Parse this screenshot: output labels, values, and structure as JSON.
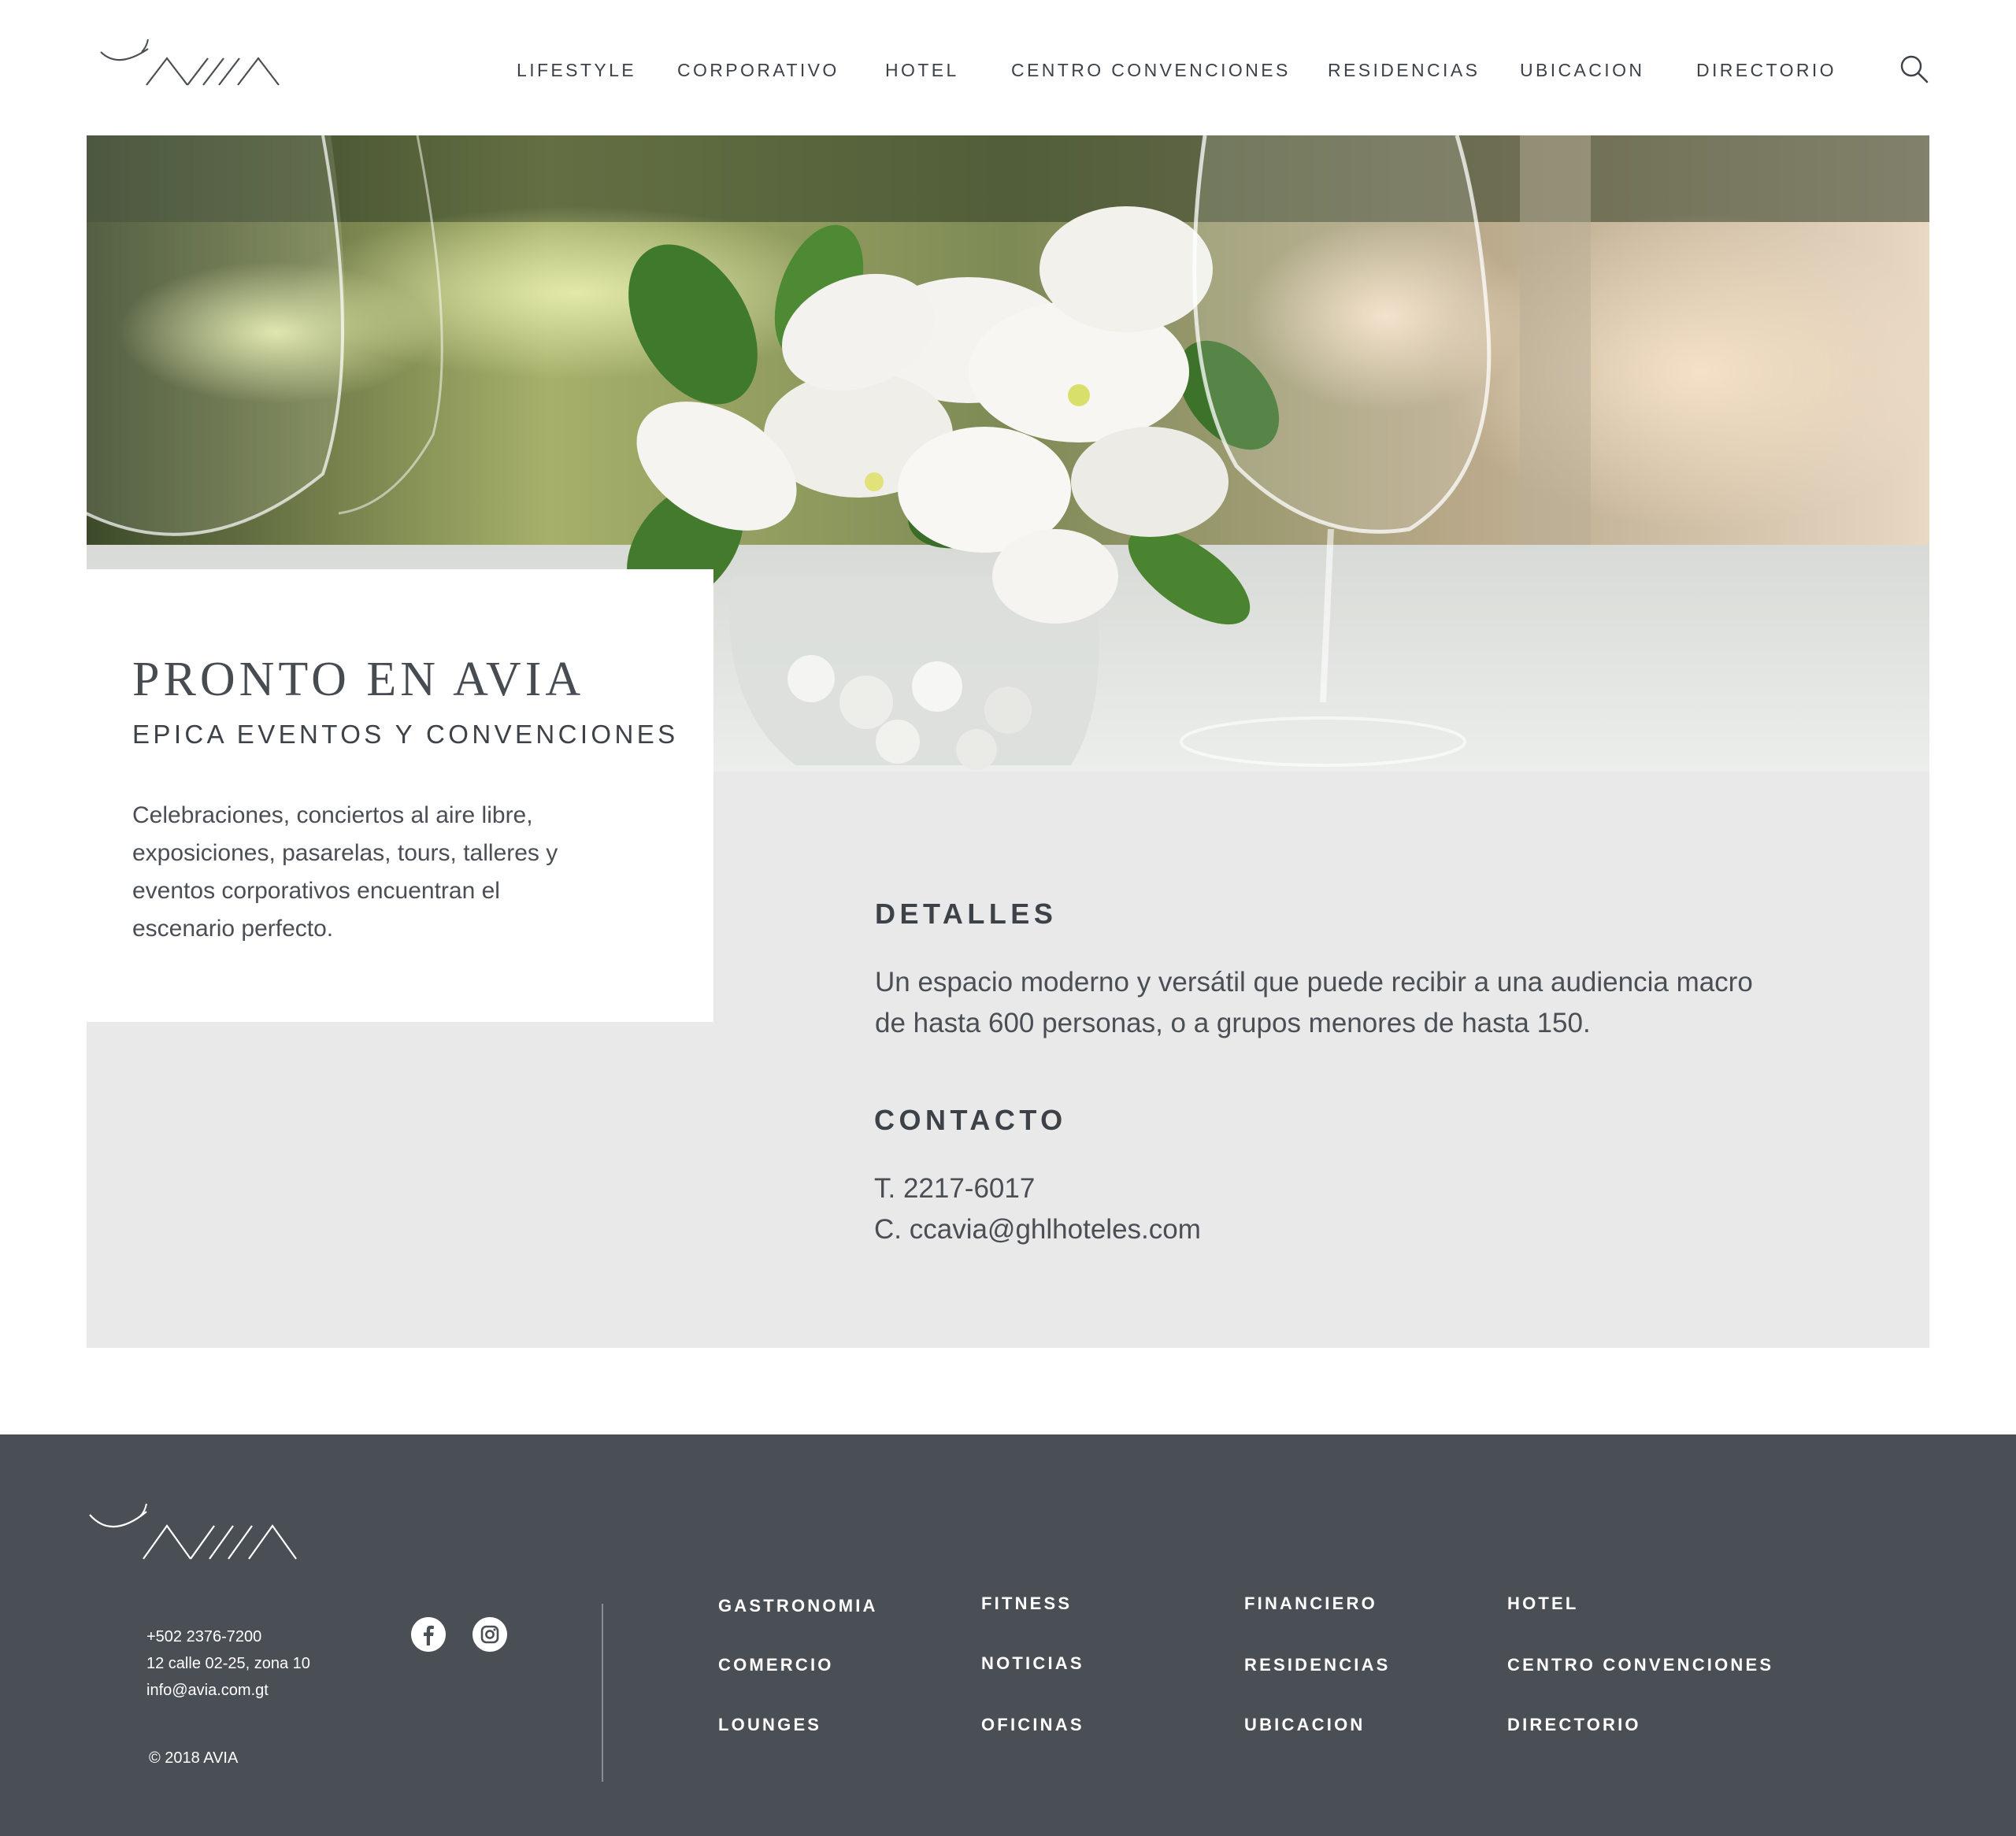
{
  "header": {
    "logo_name": "AVIA",
    "nav": [
      "LIFESTYLE",
      "CORPORATIVO",
      "HOTEL",
      "CENTRO CONVENCIONES",
      "RESIDENCIAS",
      "UBICACION",
      "DIRECTORIO"
    ]
  },
  "card": {
    "title": "PRONTO EN AVIA",
    "subtitle": "EPICA EVENTOS Y CONVENCIONES",
    "body": "Celebraciones, conciertos al aire libre, exposiciones, pasarelas, tours, talleres y eventos corporativos encuentran el escenario perfecto."
  },
  "details": {
    "heading": "DETALLES",
    "text": "Un espacio moderno y versátil que puede recibir a una audiencia macro de hasta 600 personas, o a grupos menores de hasta 150."
  },
  "contact": {
    "heading": "CONTACTO",
    "phone": "T. 2217-6017",
    "email": "C. ccavia@ghlhoteles.com"
  },
  "footer": {
    "phone": "+502 2376-7200",
    "address": "12 calle 02-25, zona 10",
    "email": "info@avia.com.gt",
    "copyright": "© 2018 AVIA",
    "links": [
      [
        "GASTRONOMIA",
        "COMERCIO",
        "LOUNGES"
      ],
      [
        "FITNESS",
        "NOTICIAS",
        "OFICINAS"
      ],
      [
        "FINANCIERO",
        "RESIDENCIAS",
        "UBICACION"
      ],
      [
        "HOTEL",
        "CENTRO CONVENCIONES",
        "DIRECTORIO"
      ]
    ]
  },
  "colors": {
    "text_dark": "#3d4148",
    "footer_bg": "#4a4e55",
    "gray_band": "#e9e9e9"
  },
  "icons": [
    "search-icon",
    "facebook-icon",
    "instagram-icon"
  ]
}
